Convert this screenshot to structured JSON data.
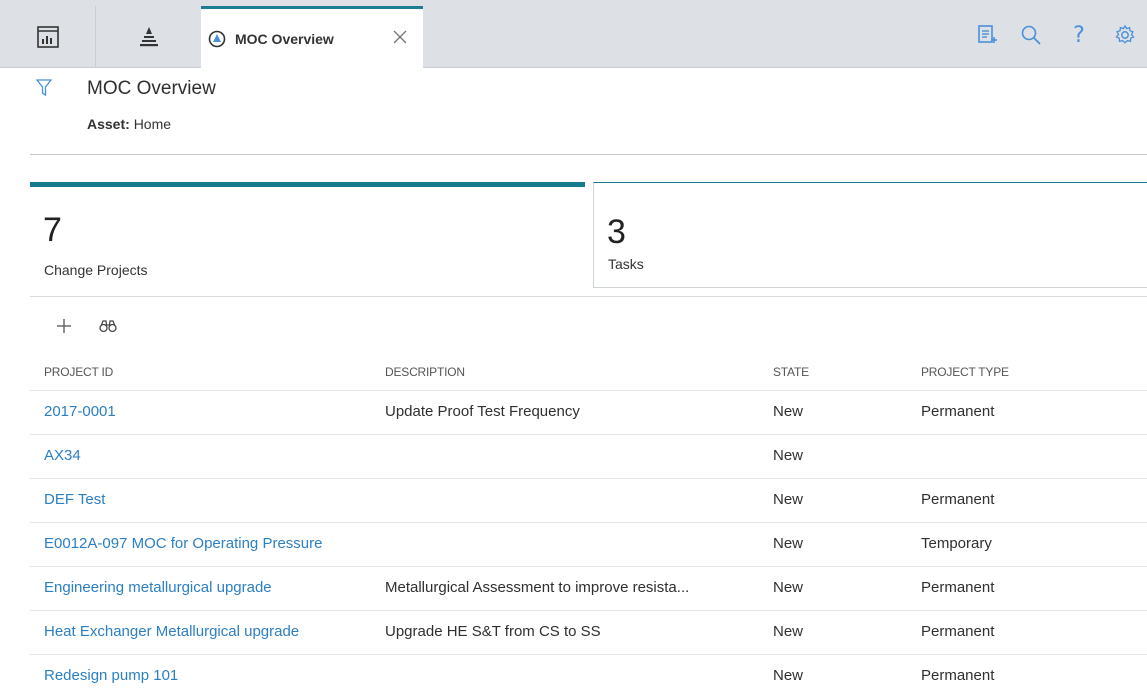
{
  "topbar": {
    "active_tab": {
      "label": "MOC Overview",
      "icon": "moc-icon"
    },
    "nav_icons": [
      "dashboard-icon",
      "asset-hierarchy-icon"
    ],
    "tools": [
      "new-record-icon",
      "search-icon",
      "help-icon",
      "gear-icon"
    ],
    "help_glyph": "?"
  },
  "header": {
    "title": "MOC Overview",
    "asset_label": "Asset:",
    "asset_value": "Home"
  },
  "cards": [
    {
      "count": "7",
      "label": "Change Projects",
      "active": true
    },
    {
      "count": "3",
      "label": "Tasks",
      "active": false
    }
  ],
  "actions": [
    "add-icon",
    "find-icon"
  ],
  "table": {
    "columns": [
      "PROJECT ID",
      "DESCRIPTION",
      "STATE",
      "PROJECT TYPE"
    ],
    "rows": [
      {
        "id": "2017-0001",
        "description": "Update Proof Test Frequency",
        "state": "New",
        "type": "Permanent"
      },
      {
        "id": "AX34",
        "description": "",
        "state": "New",
        "type": ""
      },
      {
        "id": "DEF Test",
        "description": "",
        "state": "New",
        "type": "Permanent"
      },
      {
        "id": "E0012A-097 MOC for Operating Pressure",
        "description": "",
        "state": "New",
        "type": "Temporary"
      },
      {
        "id": "Engineering metallurgical upgrade",
        "description": "Metallurgical Assessment to improve resista...",
        "state": "New",
        "type": "Permanent"
      },
      {
        "id": "Heat Exchanger Metallurgical upgrade",
        "description": "Upgrade HE S&T from CS to SS",
        "state": "New",
        "type": "Permanent"
      },
      {
        "id": "Redesign pump 101",
        "description": "",
        "state": "New",
        "type": "Permanent"
      }
    ]
  },
  "colors": {
    "accent": "#167b8f",
    "link": "#2b7fc3",
    "icon": "#4a90d9"
  }
}
